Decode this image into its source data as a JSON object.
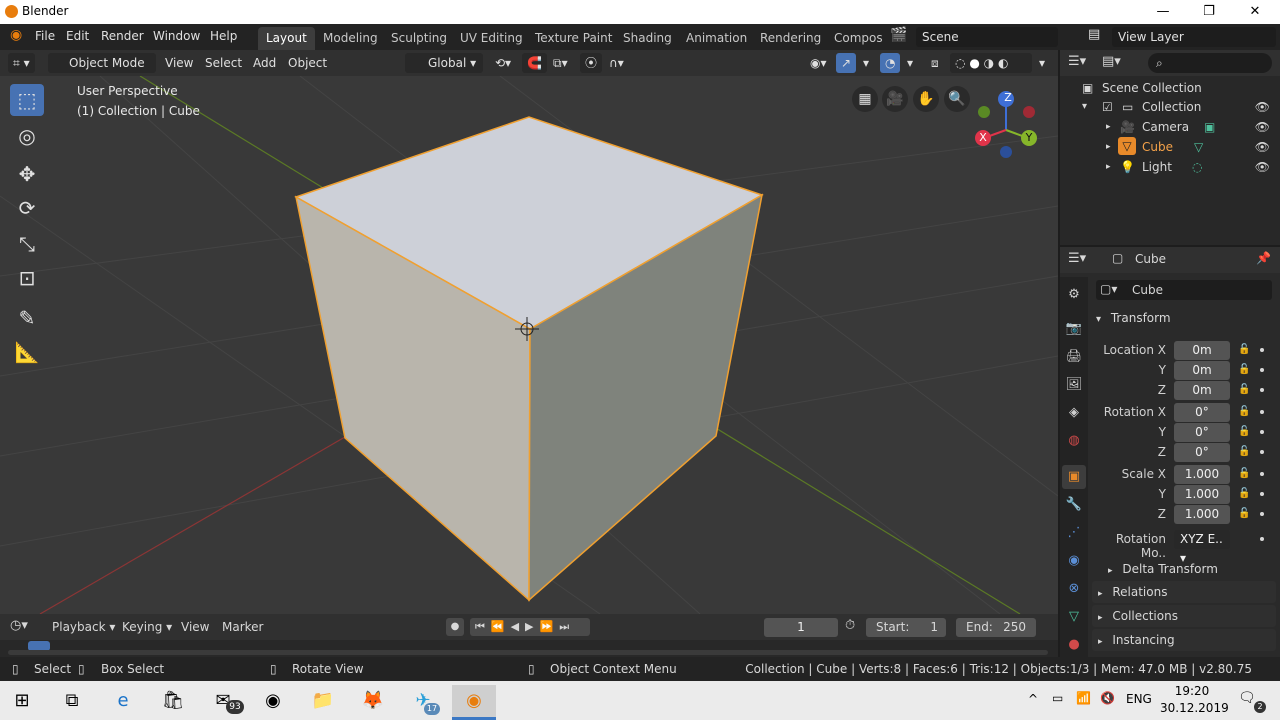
{
  "window": {
    "title": "Blender",
    "minimize": "—",
    "restore": "❐",
    "close": "✕"
  },
  "topbar": {
    "menus": [
      "File",
      "Edit",
      "Render",
      "Window",
      "Help"
    ],
    "workspaces": [
      "Layout",
      "Modeling",
      "Sculpting",
      "UV Editing",
      "Texture Paint",
      "Shading",
      "Animation",
      "Rendering",
      "Compos"
    ],
    "scene": "Scene",
    "view_layer": "View Layer"
  },
  "viewport_header": {
    "mode": "Object Mode",
    "menus": [
      "View",
      "Select",
      "Add",
      "Object"
    ],
    "orientation": "Global"
  },
  "viewport": {
    "perspective": "User Perspective",
    "collection_info": "(1) Collection | Cube",
    "axis_x": "X",
    "axis_y": "Y",
    "axis_z": "Z"
  },
  "outliner": {
    "root": "Scene Collection",
    "collection": "Collection",
    "items": [
      "Camera",
      "Cube",
      "Light"
    ]
  },
  "properties": {
    "object_name": "Cube",
    "datablock": "Cube",
    "panel_transform": "Transform",
    "location_label": "Location X",
    "rotation_label": "Rotation X",
    "scale_label": "Scale X",
    "y_label": "Y",
    "z_label": "Z",
    "location": [
      "0m",
      "0m",
      "0m"
    ],
    "rotation": [
      "0°",
      "0°",
      "0°"
    ],
    "scale": [
      "1.000",
      "1.000",
      "1.000"
    ],
    "rotation_mode_label": "Rotation Mo..",
    "rotation_mode": "XYZ E..",
    "delta": "Delta Transform",
    "sections": [
      "Relations",
      "Collections",
      "Instancing"
    ]
  },
  "timeline": {
    "menus": [
      "Playback",
      "Keying",
      "View",
      "Marker"
    ],
    "current_frame": "1",
    "start_label": "Start:",
    "start": "1",
    "end_label": "End:",
    "end": "250"
  },
  "statusbar": {
    "select": "Select",
    "box_select": "Box Select",
    "rotate": "Rotate View",
    "context": "Object Context Menu",
    "stats": "Collection | Cube | Verts:8 | Faces:6 | Tris:12 | Objects:1/3 | Mem: 47.0 MB | v2.80.75"
  },
  "taskbar": {
    "mail_badge": "93",
    "telegram_badge": "17",
    "lang": "ENG",
    "time": "19:20",
    "date": "30.12.2019",
    "notif": "2"
  }
}
